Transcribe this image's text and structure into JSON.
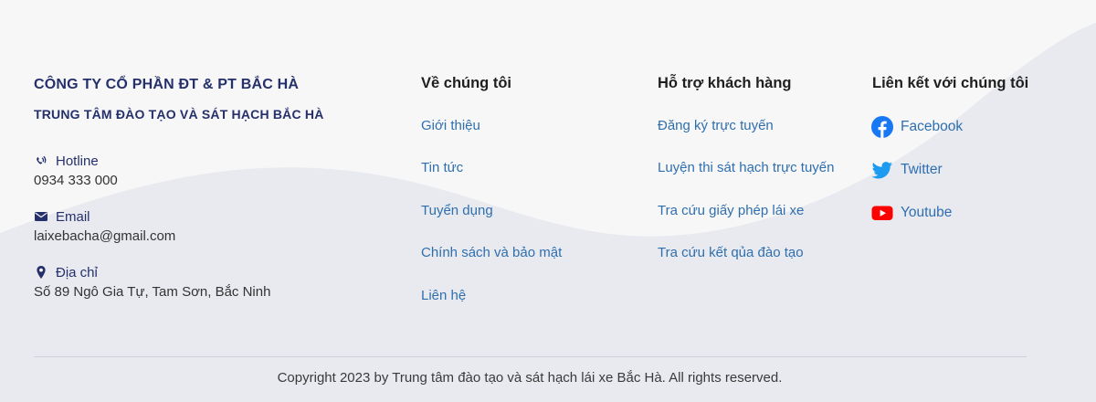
{
  "company": {
    "name": "CÔNG TY CỔ PHẦN ĐT & PT BẮC HÀ",
    "center_name": "TRUNG TÂM ĐÀO TẠO VÀ SÁT HẠCH BẮC HÀ"
  },
  "contacts": [
    {
      "icon": "phone-volume-icon",
      "label": "Hotline",
      "value": "0934 333 000"
    },
    {
      "icon": "envelope-icon",
      "label": "Email",
      "value": "laixebacha@gmail.com"
    },
    {
      "icon": "map-pin-icon",
      "label": "Địa chỉ",
      "value": "Số 89 Ngô Gia Tự, Tam Sơn, Bắc Ninh"
    }
  ],
  "columns": [
    {
      "title": "Về chúng tôi",
      "links": [
        "Giới thiệu",
        "Tin tức",
        "Tuyển dụng",
        "Chính sách và bảo mật",
        "Liên hệ"
      ]
    },
    {
      "title": "Hỗ trợ khách hàng",
      "links": [
        "Đăng ký trực tuyến",
        "Luyện thi sát hạch trực tuyến",
        "Tra cứu giấy phép lái xe",
        "Tra cứu kết qủa đào tạo"
      ]
    }
  ],
  "social": {
    "title": "Liên kết với chúng tôi",
    "items": [
      {
        "icon": "facebook-icon",
        "label": "Facebook",
        "color": "#1877f2"
      },
      {
        "icon": "twitter-icon",
        "label": "Twitter",
        "color": "#1d9bf0"
      },
      {
        "icon": "youtube-icon",
        "label": "Youtube",
        "color": "#ff0000"
      }
    ]
  },
  "copyright": "Copyright 2023 by Trung tâm đào tạo và sát hạch lái xe Bắc Hà. All rights reserved.",
  "colors": {
    "background": "#f7f7f8",
    "wave": "#e8eaf0",
    "brand_navy": "#25306b",
    "link_blue": "#2f6fae"
  }
}
